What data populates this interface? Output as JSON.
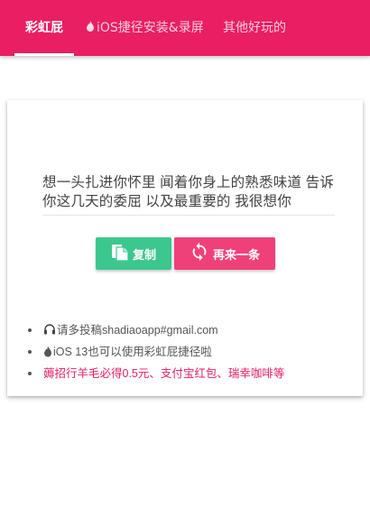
{
  "app": {
    "tabs": [
      {
        "label": "彩虹屁",
        "active": true
      },
      {
        "label": "iOS捷径安装&录屏",
        "icon": "fire-icon"
      },
      {
        "label": "其他好玩的"
      }
    ]
  },
  "colors": {
    "brand": "#e91e63",
    "copy_button": "#3cc78f",
    "next_button": "#f0407a"
  },
  "card": {
    "quote": "想一头扎进你怀里 闻着你身上的熟悉味道 告诉你这几天的委屈 以及最重要的 我很想你",
    "copy_label": "复制",
    "next_label": "再来一条"
  },
  "notes": [
    {
      "text": "请多投稿shadiaoapp#gmail.com",
      "icon": "headset-icon"
    },
    {
      "text": "iOS 13也可以使用彩虹屁捷径啦",
      "icon": "fire-icon"
    },
    {
      "text": "薅招行羊毛必得0.5元、支付宝红包、瑞幸咖啡等",
      "icon": "",
      "pink": true
    }
  ]
}
